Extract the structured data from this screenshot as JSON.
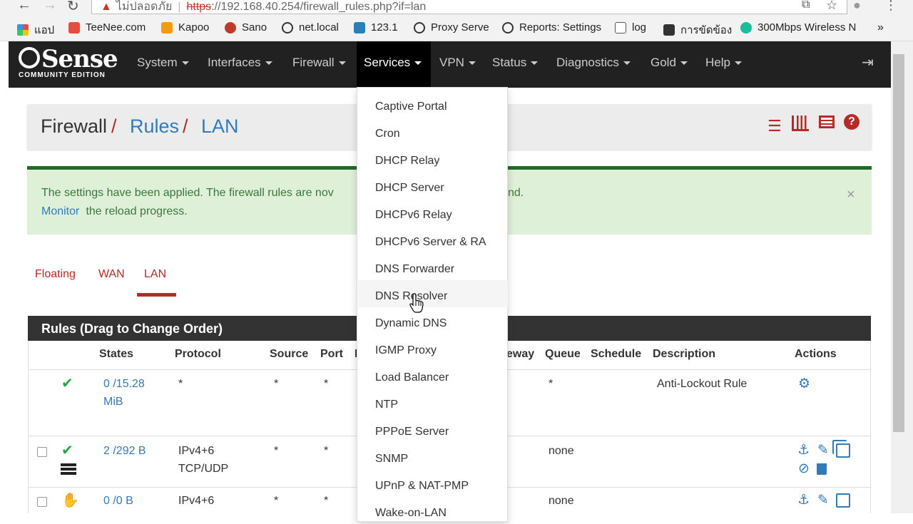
{
  "browser": {
    "url_warning": "ไม่ปลอดภัย",
    "url_scheme": "https",
    "url_rest": "://192.168.40.254/firewall_rules.php?if=lan",
    "bookmarks": [
      "แอป",
      "TeeNee.com",
      "Kapoo",
      "Sano",
      "net.local",
      "123.1",
      "Proxy Serve",
      "Reports: Settings",
      "log",
      "การขัดข้อง",
      "300Mbps Wireless N"
    ]
  },
  "logo": {
    "main": "Sense",
    "sub": "COMMUNITY EDITION"
  },
  "menu": [
    "System",
    "Interfaces",
    "Firewall",
    "Services",
    "VPN",
    "Status",
    "Diagnostics",
    "Gold",
    "Help"
  ],
  "breadcrumb": {
    "root": "Firewall",
    "sep": "/",
    "level1": "Rules",
    "level2": "LAN"
  },
  "alert": {
    "line1a": "The settings have been applied. The firewall rules are nov",
    "line1b": "nd.",
    "link": "Monitor",
    "line2": " the reload progress.",
    "close": "×"
  },
  "tabs": [
    "Floating",
    "WAN",
    "LAN"
  ],
  "panel": {
    "title": "Rules (Drag to Change Order)"
  },
  "table": {
    "headers": [
      "States",
      "Protocol",
      "Source",
      "Port",
      "D",
      "eway",
      "Queue",
      "Schedule",
      "Description",
      "Actions"
    ],
    "rows": [
      {
        "states_a": "0 /15.28",
        "states_b": "MiB",
        "protocol": "*",
        "source": "*",
        "port": "*",
        "queue": "*",
        "description": "Anti-Lockout Rule"
      },
      {
        "states_a": "2 /292 B",
        "protocol": "IPv4+6",
        "protocol_b": "TCP/UDP",
        "source": "*",
        "port": "*",
        "queue": "none"
      },
      {
        "states_a": "0 /0 B",
        "protocol": "IPv4+6",
        "source": "*",
        "port": "*",
        "queue": "none"
      }
    ]
  },
  "services_dropdown": [
    "Captive Portal",
    "Cron",
    "DHCP Relay",
    "DHCP Server",
    "DHCPv6 Relay",
    "DHCPv6 Server & RA",
    "DNS Forwarder",
    "DNS Resolver",
    "Dynamic DNS",
    "IGMP Proxy",
    "Load Balancer",
    "NTP",
    "PPPoE Server",
    "SNMP",
    "UPnP & NAT-PMP",
    "Wake-on-LAN"
  ],
  "colors": {
    "brand_red": "#b52b27",
    "link_blue": "#337ab7",
    "navbar": "#212121",
    "alert_bg": "#dff0d8",
    "ok_green": "#27a744"
  }
}
